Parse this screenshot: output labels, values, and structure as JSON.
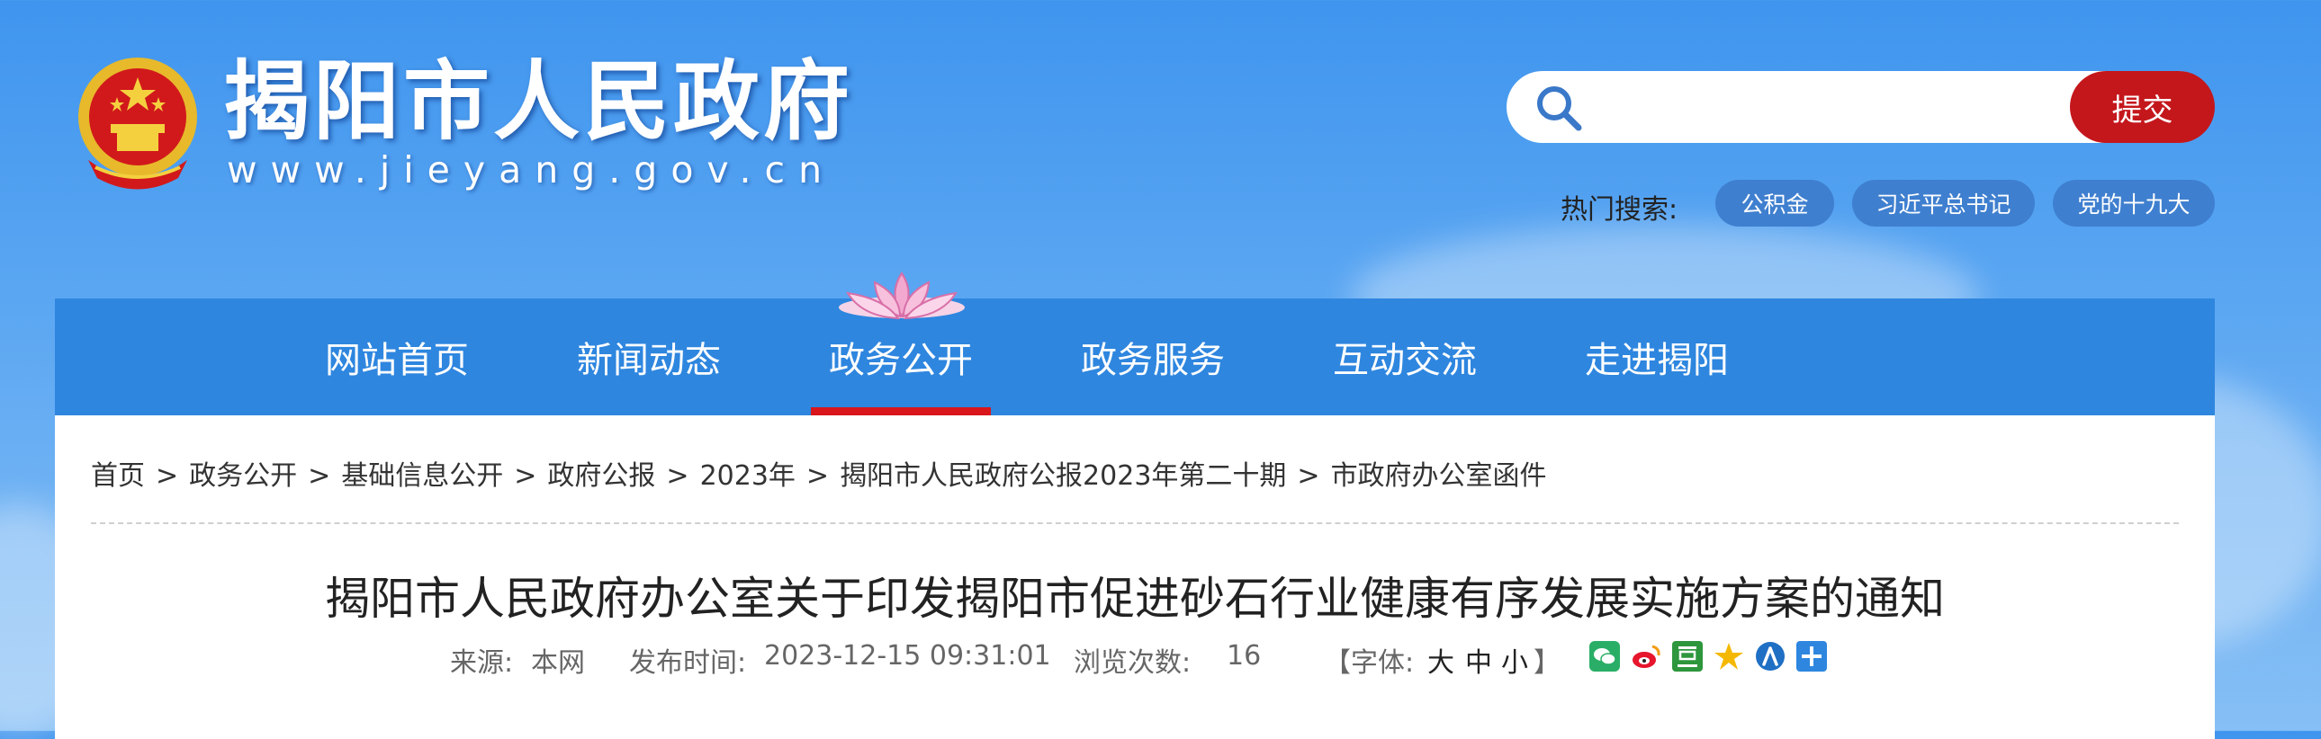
{
  "header": {
    "site_title": "揭阳市人民政府",
    "site_url": "www.jieyang.gov.cn"
  },
  "search": {
    "placeholder": "",
    "value": "",
    "submit_label": "提交",
    "hot_label": "热门搜索:",
    "hot_tags": [
      "公积金",
      "习近平总书记",
      "党的十九大"
    ]
  },
  "nav": {
    "items": [
      "网站首页",
      "新闻动态",
      "政务公开",
      "政务服务",
      "互动交流",
      "走进揭阳"
    ],
    "active": "政务公开"
  },
  "breadcrumb": {
    "items": [
      "首页",
      "政务公开",
      "基础信息公开",
      "政府公报",
      "2023年",
      "揭阳市人民政府公报2023年第二十期",
      "市政府办公室函件"
    ],
    "separator": ">"
  },
  "article": {
    "title": "揭阳市人民政府办公室关于印发揭阳市促进砂石行业健康有序发展实施方案的通知",
    "source_label": "来源:",
    "source_value": "本网",
    "publish_label": "发布时间:",
    "publish_value": "2023-12-15 09:31:01",
    "views_label": "浏览次数:",
    "views_value": "16",
    "font_label": "【字体:",
    "font_large": "大",
    "font_medium": "中",
    "font_small": "小",
    "font_close": "】"
  },
  "share_icons": [
    "wechat-icon",
    "weibo-icon",
    "douban-icon",
    "qzone-icon",
    "renren-icon",
    "more-share-icon"
  ],
  "colors": {
    "nav_bg": "#2e86df",
    "submit_bg": "#c4171c",
    "hot_tag_bg": "#3f7fcf",
    "active_bar": "#d8161b"
  }
}
